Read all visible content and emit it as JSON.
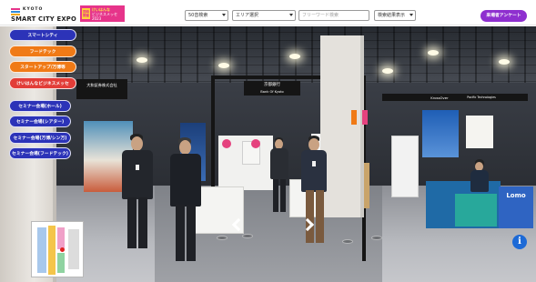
{
  "header": {
    "logo": {
      "kyoto": "KYOTO",
      "smart_city_expo": "SMART CITY EXPO",
      "badge_top": "けいはんな",
      "badge_main": "ビジネスメッセ2023",
      "badge_tag": "同時開催"
    },
    "filters": {
      "category": {
        "selected": "50音検索"
      },
      "area": {
        "selected": "エリア選択"
      },
      "keyword": {
        "placeholder": "フリーワード検索",
        "value": ""
      },
      "result": {
        "selected": "検索結果表示"
      }
    },
    "survey_button": "来場者アンケート"
  },
  "side_menu": [
    {
      "label": "スマートシティ",
      "color": "#2c33b8"
    },
    {
      "label": "フードテック",
      "color": "#f07a16"
    },
    {
      "label": "スタートアップ/万博等",
      "color": "#f07a16"
    },
    {
      "label": "けいはんなビジネスメッセ",
      "color": "#e23d38"
    },
    {
      "label": "セミナー会場(ホール)",
      "color": "#2c33b8"
    },
    {
      "label": "セミナー会場(シアター)",
      "color": "#2c33b8"
    },
    {
      "label": "セミナー会場(万博/シン万)",
      "color": "#2c33b8"
    },
    {
      "label": "セミナー会場(フードテック)",
      "color": "#2c33b8"
    }
  ],
  "scene": {
    "booth_signs": [
      "大和証券株式会社",
      "京都銀行",
      "Bank Of Kyoto",
      "KrossOver",
      "Pacific Technologies",
      "Lomo"
    ],
    "controls": {
      "nav_left": "chevron-left-icon",
      "nav_right": "chevron-right-icon",
      "info": "i"
    }
  },
  "colors": {
    "survey": "#8e2fcf",
    "menu_blue": "#2c33b8",
    "menu_orange": "#f07a16",
    "menu_red": "#e23d38",
    "info": "#1d6ad6"
  }
}
